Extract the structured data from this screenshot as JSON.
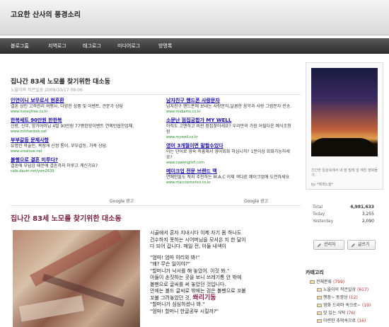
{
  "header": {
    "blog_title": "고요한 산사의 풍경소리"
  },
  "nav": {
    "items": [
      "블로그홈",
      "지역로그",
      "태그로그",
      "미디어로그",
      "방명록"
    ]
  },
  "post": {
    "title": "집나간 83세 노모를 찾기위한 대소동",
    "meta": "노을이의 작은일상  2009/10/17 09:06",
    "heading": "집나간 83세 노모를 찾기위한 대소동"
  },
  "ads": {
    "left": [
      {
        "title": "인연이니 보무로서 현혼환",
        "body": "결혼 상인 고객관리 여행사, 다양한 상품 및 이벤트, 견문가 상담",
        "url": "www.honeytree.co.kr"
      },
      {
        "title": "한복세트 90만원 한한복",
        "body": "신랑, 신부, 양가어머님 4벌 90만원 77평한장이벤트 연예인협찬업체.",
        "url": "www.minhanbok.net"
      },
      {
        "title": "부부갈등 문제사항",
        "body": "유명한 학술인, 목장게 신정 통이, 부부갈등, 가족 상담.",
        "url": "www.ursalove.net"
      },
      {
        "title": "불행으로 결혼 미루다?",
        "body": "결혼에 부담감 때문에 결혼까지 미루고 계신가요?",
        "url": "cafe.daum.net/yom2639"
      }
    ],
    "right": [
      {
        "title": "남자친구 핸드폰 사랑문자",
        "body": "남자친구 핸드폰에 보내는 사랑문자,달콤한 음악과 사랑 그림문자 전송.",
        "url": "www.mobams.co.kr"
      },
      {
        "title": "소문난 점집궁합가 MY WELL",
        "body": "아직도 고맨하고 비싼 점집찾아세요? 우리만의 가장 어릴다운 예식조청장",
        "url": "www.mywell.co.kr"
      },
      {
        "title": "영어 3개월이면 말할수있다",
        "body": "아는 단어로 영숙 즉흥해서 영어회화 하십니까? 1분이상 회화가능하세요?",
        "url": "www.nawenglish.com"
      },
      {
        "title": "메이크업 전문 브랜드 맥",
        "body": "연예인들도 착지 추천하는 M.A.C 이제 색다른 메이크업에 도전하세요",
        "url": "www.maccosmetics.co.kr"
      }
    ],
    "by_label": "Google 광고"
  },
  "body_text": [
    "시골에서 혼자 지내시다 이제 자기 몸 하나도",
    "건수하지 못하는 시어머님을 모셔온 지 한 달이",
    "다 되어 갑니다. 매일 전, 아들 내색이",
    "",
    "\"엄마! 엄마 이리와 봐!\"",
    "\"왜? 무슨 일이야?\"",
    "\"할머니가 낙서를 해 놓았어. 이것 봐.\"",
    "아들이 손짓하는 곳을 보니 쓰레기통 안 밖에",
    "볼펜으로 글씨를 써 놓았던 것입니다.",
    "안에는 볼드 글씨로 밖에는 검은 볼펜으로 꼬불",
    "꼬불 그려놓았던 것, ",
    "\"할머니가 심심하셨나 봐.\"",
    "\"엄마! 할머니 한글공부 시킬까?\""
  ],
  "emphasis": "쏴리기동",
  "profile": {
    "caption": "간간한 일상속에서 내 맘 밀레 앞 에진 행복들가.",
    "by": "by  *채색노을*"
  },
  "stats": [
    {
      "label": "Total",
      "value": "4,981,633"
    },
    {
      "label": "Today",
      "value": "3,255"
    },
    {
      "label": "Yesterday",
      "value": "2,090"
    }
  ],
  "buttons": {
    "admin": "관리자",
    "write": "글쓰기"
  },
  "categories": {
    "title": "카테고리",
    "items": [
      {
        "name": "전체분류",
        "count": "(799)"
      },
      {
        "name": "노을이의 작은일상",
        "count": "(617)"
      },
      {
        "name": "행장~ 동영상",
        "count": "(12)"
      },
      {
        "name": "영화 드라마 속으로~",
        "count": "(19)"
      },
      {
        "name": "맛 있는 식탁",
        "count": "(76)"
      },
      {
        "name": "아련한 추억속으로",
        "count": "(16)"
      }
    ]
  },
  "colors": {
    "accent": "#7a2040",
    "link": "#1a0dab",
    "nav_bg": "#3a3a3a"
  }
}
